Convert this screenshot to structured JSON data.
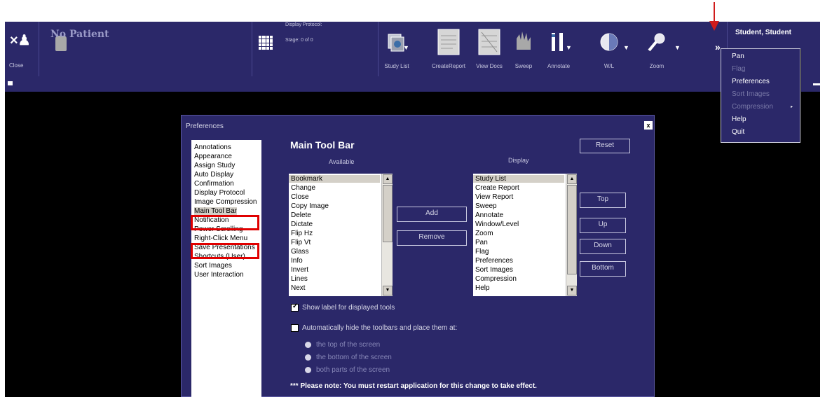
{
  "toolbar": {
    "close_label": "Close",
    "patient": "No Patient",
    "display_protocol_title": "Display Protocol:",
    "stage": "Stage: 0 of 0",
    "tools": [
      "Study List",
      "CreateReport",
      "View Docs",
      "Sweep",
      "Annotate",
      "W/L",
      "Zoom"
    ],
    "more": "»",
    "user": "Student, Student"
  },
  "menu": {
    "items": [
      {
        "label": "Pan",
        "enabled": true
      },
      {
        "label": "Flag",
        "enabled": false
      },
      {
        "label": "Preferences",
        "enabled": true
      },
      {
        "label": "Sort Images",
        "enabled": false
      },
      {
        "label": "Compression",
        "enabled": false
      },
      {
        "label": "Help",
        "enabled": true
      },
      {
        "label": "Quit",
        "enabled": true
      }
    ],
    "submenu_marker": "▸"
  },
  "dialog": {
    "title": "Preferences",
    "close": "x",
    "categories": [
      "Annotations",
      "Appearance",
      "Assign Study",
      "Auto Display",
      "Confirmation",
      "Display Protocol",
      "Image Compression",
      "Main Tool Bar",
      "Notification",
      "Power Scrolling",
      "Right-Click Menu",
      "Save Presentations",
      "Shortcuts (User)",
      "Sort Images",
      "User Interaction"
    ],
    "selected_category": "Main Tool Bar",
    "section_title": "Main Tool Bar",
    "reset": "Reset",
    "available_header": "Available",
    "display_header": "Display",
    "available": [
      "Bookmark",
      "Change",
      "Close",
      "Copy Image",
      "Delete",
      "Dictate",
      "Flip Hz",
      "Flip Vt",
      "Glass",
      "Info",
      "Invert",
      "Lines",
      "Next"
    ],
    "display": [
      "Study List",
      "Create Report",
      "View Report",
      "Sweep",
      "Annotate",
      "Window/Level",
      "Zoom",
      "Pan",
      "Flag",
      "Preferences",
      "Sort Images",
      "Compression",
      "Help"
    ],
    "add": "Add",
    "remove": "Remove",
    "top": "Top",
    "up": "Up",
    "down": "Down",
    "bottom": "Bottom",
    "show_label": "Show label for displayed tools",
    "show_label_checked": true,
    "auto_hide": "Automatically hide the toolbars and place them at:",
    "auto_hide_checked": false,
    "positions": [
      "the top of the screen",
      "the bottom of the screen",
      "both parts of the screen"
    ],
    "note": "*** Please note: You must restart application for this change to take effect."
  },
  "colors": {
    "toolbar_bg": "#2b2869",
    "highlight": "#e00000",
    "arrow": "#d01c1c"
  }
}
